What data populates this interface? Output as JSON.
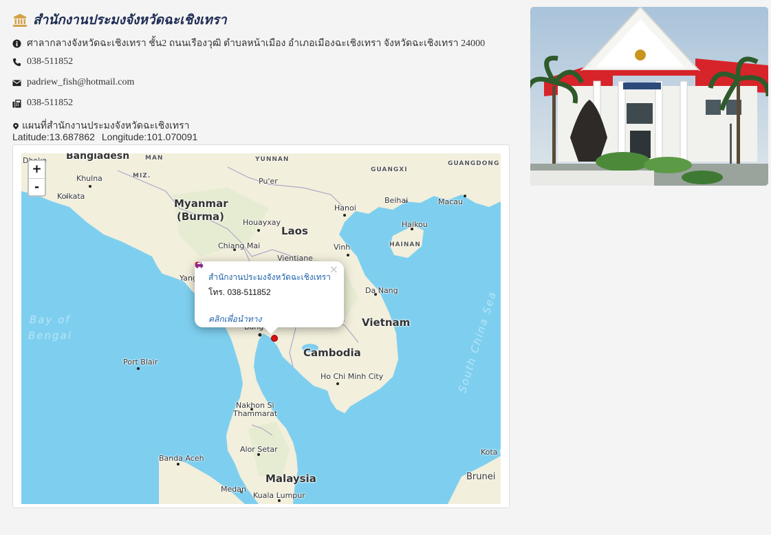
{
  "header": {
    "title": "สำนักงานประมงจังหวัดฉะเชิงเทรา",
    "icon": "bank-icon"
  },
  "contact": {
    "address": "ศาลากลางจังหวัดฉะเชิงเทรา ชั้น2 ถนนเรืองวุฒิ  ตำบลหน้าเมือง อำเภอเมืองฉะเชิงเทรา จังหวัดฉะเชิงเทรา  24000",
    "phone": "038-511852",
    "email": "padriew_fish@hotmail.com",
    "fax": "038-511852",
    "map_label": "แผนที่สำนักงานประมงจังหวัดฉะเชิงเทรา",
    "latitude": "Latitude:13.687862",
    "longitude": "Longitude:101.070091"
  },
  "map": {
    "zoom_in": "+",
    "zoom_out": "-",
    "popup": {
      "title": "สำนักงานประมงจังหวัดฉะเชิงเทรา",
      "phone": "โทร. 038-511852",
      "directions": "คลิกเพื่อนำทาง",
      "close": "×"
    },
    "labels": {
      "bangladesh": "Bangladesh",
      "man": "MAN",
      "yunnan": "YUNNAN",
      "guangxi": "GUANGXI",
      "guangdong": "GUANGDONG",
      "dhaka": "Dhaka",
      "khulna": "Khulna",
      "miz": "MIZ.",
      "kolkata": "Kolkata",
      "myanmar": "Myanmar",
      "burma": "(Burma)",
      "puer": "Pu'er",
      "hanoi": "Hanoi",
      "beihai": "Beihai",
      "macau": "Macau",
      "houayxay": "Houayxay",
      "haikou": "Haikou",
      "laos": "Laos",
      "hainan": "HAINAN",
      "chiangmai": "Chiang Mai",
      "vinh": "Vinh",
      "vientiane": "Vientiane",
      "yangon": "Yang",
      "danang": "Da Nang",
      "bayofbengal1": "Bay of",
      "bayofbengal2": "Bengal",
      "vietnam": "Vietnam",
      "bangkok": "Bang",
      "southchinasea": "South China Sea",
      "cambodia": "Cambodia",
      "portblair": "Port Blair",
      "hochiminh": "Ho Chi Minh City",
      "nakhon1": "Nakhon Si",
      "nakhon2": "Thammarat",
      "alorsetar": "Alor Setar",
      "kotak": "Kota K",
      "bandaaceh": "Banda Aceh",
      "malaysia": "Malaysia",
      "brunei": "Brunei",
      "medan": "Medan",
      "kualalumpur": "Kuala Lumpur"
    }
  },
  "colors": {
    "title": "#1e2c52",
    "link": "#1e63a8",
    "water": "#7ecfef",
    "land": "#f2efdc",
    "marker": "#dd1111",
    "car": "#8b2a8b"
  }
}
